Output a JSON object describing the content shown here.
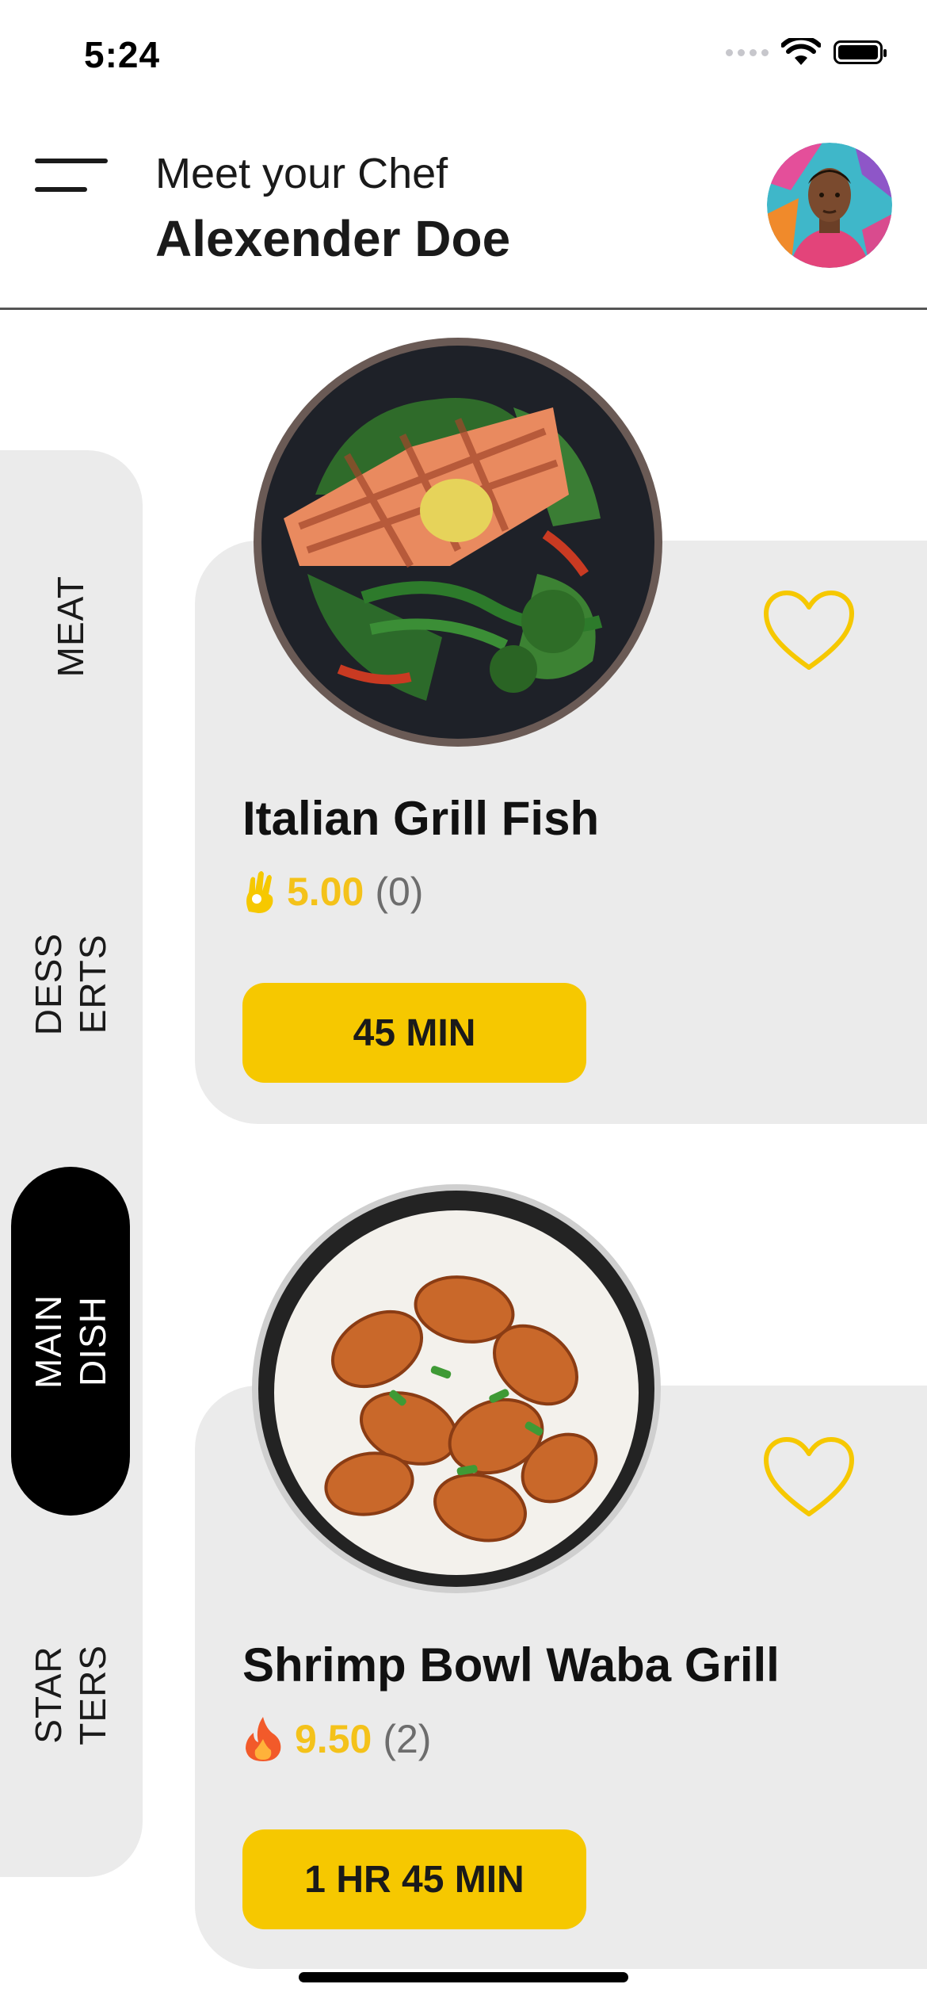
{
  "status_bar": {
    "time": "5:24"
  },
  "header": {
    "subtitle": "Meet your Chef",
    "chef_name": "Alexender Doe"
  },
  "categories": [
    {
      "label": "MEAT",
      "active": false
    },
    {
      "label": "DESS\nERTS",
      "active": false
    },
    {
      "label": "MAIN\nDISH",
      "active": true
    },
    {
      "label": "STAR\nTERS",
      "active": false
    }
  ],
  "dishes": [
    {
      "name": "Italian Grill Fish",
      "rating_icon": "ok-hand-icon",
      "rating": "5.00",
      "reviews": "(0)",
      "time": "45 MIN"
    },
    {
      "name": "Shrimp Bowl Waba Grill",
      "rating_icon": "fire-icon",
      "rating": "9.50",
      "reviews": "(2)",
      "time": "1 HR 45 MIN"
    }
  ],
  "colors": {
    "accent": "#f6c800",
    "card_bg": "#ebebeb",
    "active_tab": "#000000"
  }
}
